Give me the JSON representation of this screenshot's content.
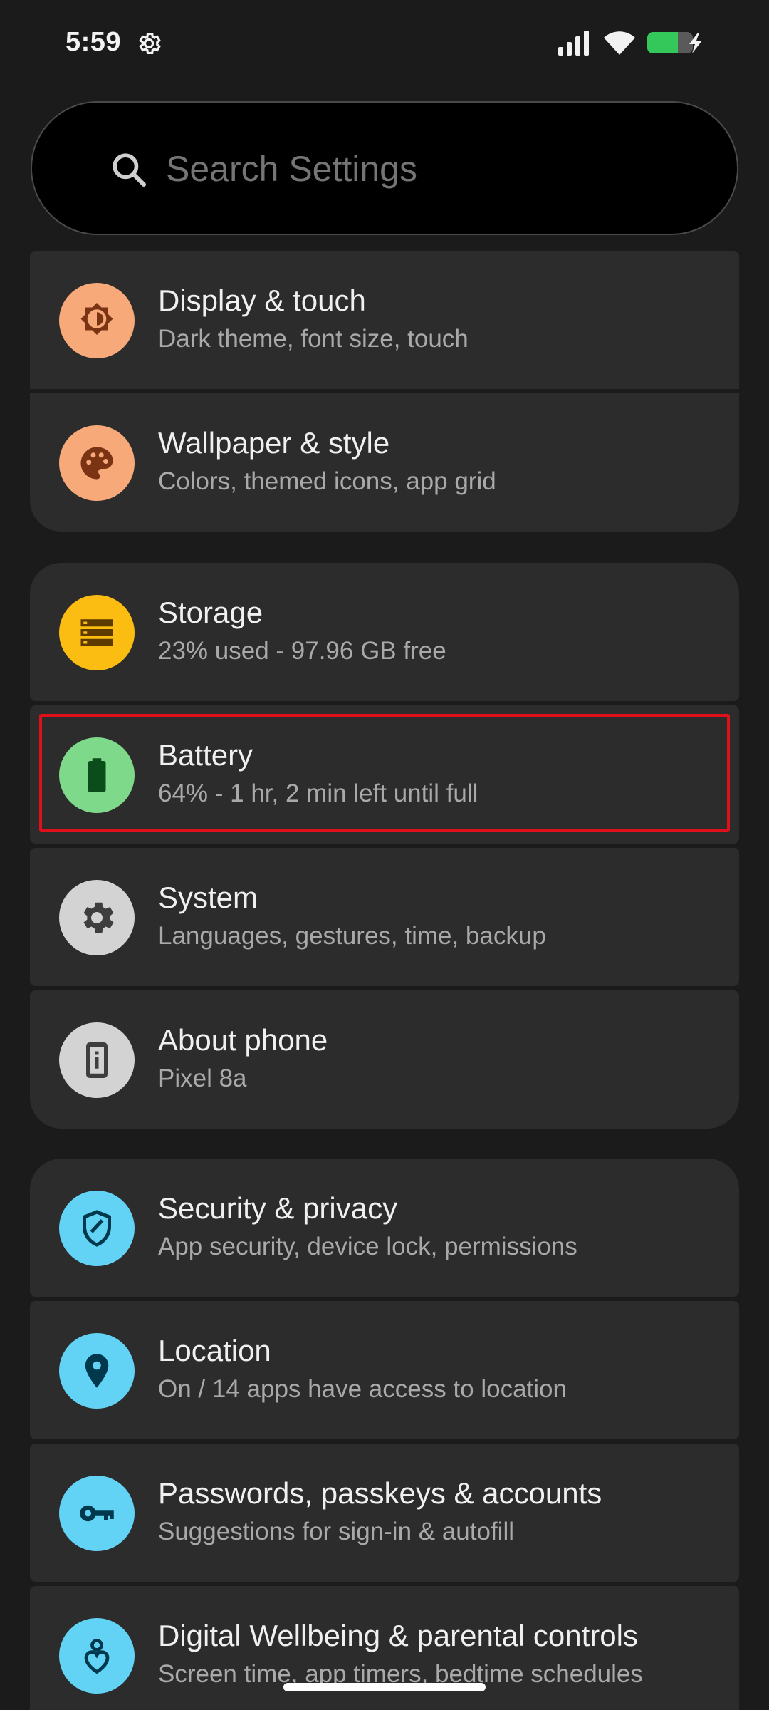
{
  "status_bar": {
    "time": "5:59",
    "icons": [
      "settings-gear-icon",
      "signal-icon",
      "wifi-icon",
      "battery-charging-icon"
    ],
    "battery_color": "#34c759"
  },
  "search": {
    "placeholder": "Search Settings"
  },
  "settings_items": [
    {
      "title": "Display & touch",
      "subtitle": "Dark theme, font size, touch",
      "icon": "display-brightness-icon",
      "icon_bg": "#f7a97a"
    },
    {
      "title": "Wallpaper & style",
      "subtitle": "Colors, themed icons, app grid",
      "icon": "palette-icon",
      "icon_bg": "#f7a97a"
    },
    {
      "title": "Storage",
      "subtitle": "23% used - 97.96 GB free",
      "icon": "storage-icon",
      "icon_bg": "#fbbd11"
    },
    {
      "title": "Battery",
      "subtitle": "64% - 1 hr, 2 min left until full",
      "icon": "battery-icon",
      "icon_bg": "#7fd98a"
    },
    {
      "title": "System",
      "subtitle": "Languages, gestures, time, backup",
      "icon": "gear-icon",
      "icon_bg": "#d3d3d3"
    },
    {
      "title": "About phone",
      "subtitle": "Pixel 8a",
      "icon": "phone-info-icon",
      "icon_bg": "#d3d3d3"
    },
    {
      "title": "Security & privacy",
      "subtitle": "App security, device lock, permissions",
      "icon": "shield-icon",
      "icon_bg": "#63d3f5"
    },
    {
      "title": "Location",
      "subtitle": "On / 14 apps have access to location",
      "icon": "location-pin-icon",
      "icon_bg": "#63d3f5"
    },
    {
      "title": "Passwords, passkeys & accounts",
      "subtitle": "Suggestions for sign-in & autofill",
      "icon": "key-icon",
      "icon_bg": "#63d3f5"
    },
    {
      "title": "Digital Wellbeing & parental controls",
      "subtitle": "Screen time, app timers, bedtime schedules",
      "icon": "wellbeing-icon",
      "icon_bg": "#63d3f5"
    }
  ],
  "highlight_color": "#e0101a"
}
